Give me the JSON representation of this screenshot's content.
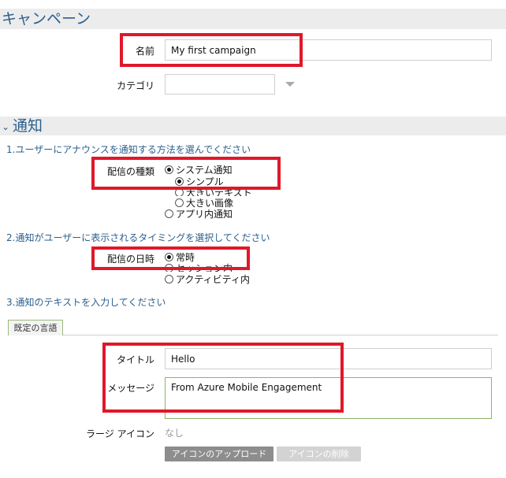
{
  "campaign": {
    "section_title": "キャンペーン",
    "name_label": "名前",
    "name_value": "My first campaign",
    "category_label": "カテゴリ",
    "category_value": ""
  },
  "notification": {
    "section_title": "通知",
    "step1": "1.ユーザーにアナウンスを通知する方法を選んでください",
    "delivery_type_label": "配信の種類",
    "delivery_types": [
      {
        "label": "システム通知",
        "selected": true
      },
      {
        "label": "シンプル",
        "selected": true
      },
      {
        "label": "大きいテキスト",
        "selected": false
      },
      {
        "label": "大きい画像",
        "selected": false
      },
      {
        "label": "アプリ内通知",
        "selected": false
      }
    ],
    "step2": "2.通知がユーザーに表示されるタイミングを選択してください",
    "delivery_time_label": "配信の日時",
    "delivery_times": [
      {
        "label": "常時",
        "selected": true
      },
      {
        "label": "セッション内",
        "selected": false
      },
      {
        "label": "アクティビティ内",
        "selected": false
      }
    ],
    "step3": "3.通知のテキストを入力してください",
    "tab_label": "既定の言語",
    "title_label": "タイトル",
    "title_value": "Hello",
    "message_label": "メッセージ",
    "message_value": "From Azure Mobile Engagement",
    "large_icon_label": "ラージ アイコン",
    "large_icon_value": "なし",
    "upload_button": "アイコンのアップロード",
    "delete_button": "アイコンの削除"
  },
  "colors": {
    "section_title": "#2b5f8e",
    "highlight": "#e0182a",
    "message_border": "#8bb56a"
  }
}
